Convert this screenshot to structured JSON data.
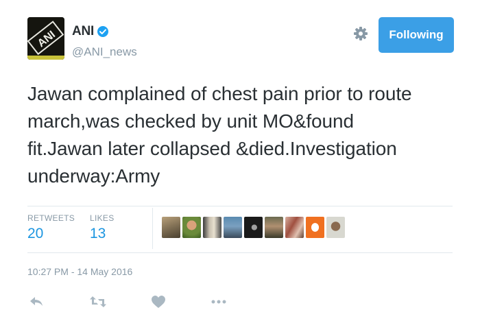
{
  "account": {
    "display_name": "ANI",
    "handle": "@ANI_news",
    "verified": true,
    "avatar_logo_text": "ANI"
  },
  "header": {
    "settings_icon": "gear-icon",
    "follow_label": "Following"
  },
  "tweet": {
    "lines": [
      "Jawan complained of chest pain prior to route",
      "march,was checked by unit MO&found",
      "fit.Jawan later collapsed &died.Investigation",
      "underway:Army"
    ]
  },
  "stats": {
    "retweets_label": "RETWEETS",
    "retweets_count": "20",
    "likes_label": "LIKES",
    "likes_count": "13"
  },
  "likers": [
    "liker-1",
    "liker-2",
    "liker-3",
    "liker-4",
    "liker-5",
    "liker-6",
    "liker-7",
    "liker-8",
    "liker-9"
  ],
  "timestamp": "10:27 PM - 14 May 2016",
  "actions": {
    "reply_icon": "reply-icon",
    "retweet_icon": "retweet-icon",
    "like_icon": "heart-icon",
    "more_icon": "more-icon"
  },
  "colors": {
    "follow_button": "#3b9fe6",
    "stat_value": "#1b95e0",
    "muted": "#8899a6",
    "text": "#292f33",
    "verified": "#1da1f2"
  }
}
